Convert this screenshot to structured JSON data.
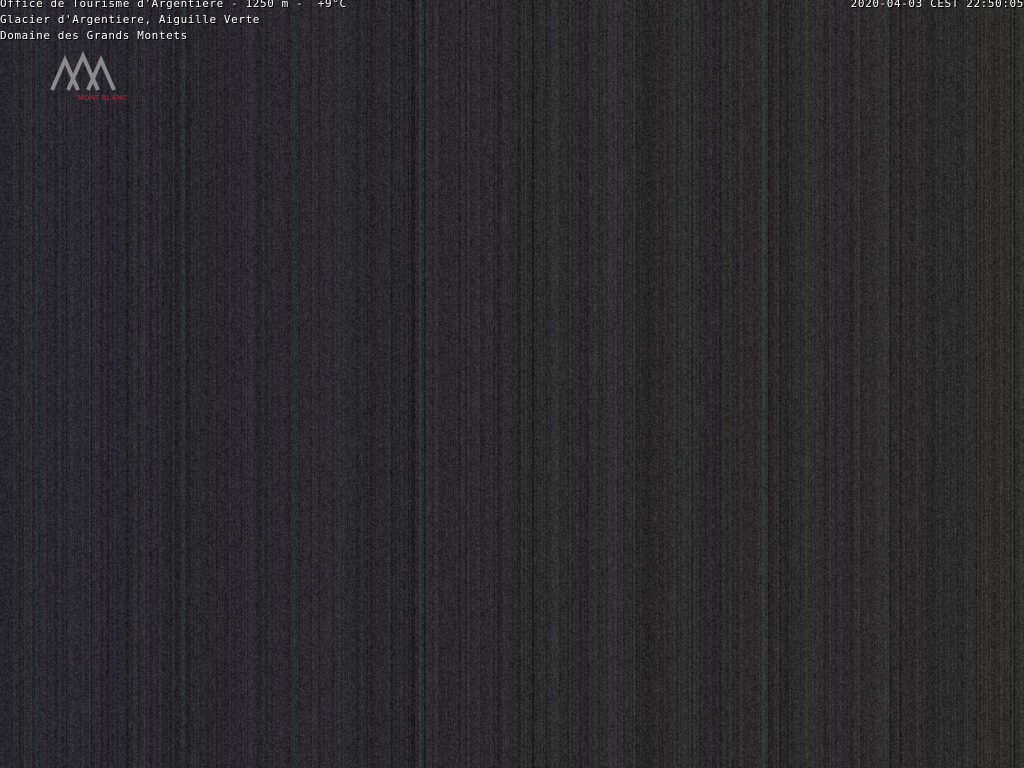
{
  "overlay": {
    "line1": "Office de Tourisme d'Argentiere - 1250 m -  +9°C",
    "line2": "Glacier d'Argentiere, Aiguille Verte",
    "line3": "Domaine des Grands Montets",
    "timestamp": "2020-04-03 CEST 22:50:05"
  },
  "logo": {
    "text": "MONT BLANC",
    "mark_color": "#8a8a8a",
    "text_color": "#9e1f2e"
  },
  "scene": {
    "base_color": "#26242b"
  }
}
